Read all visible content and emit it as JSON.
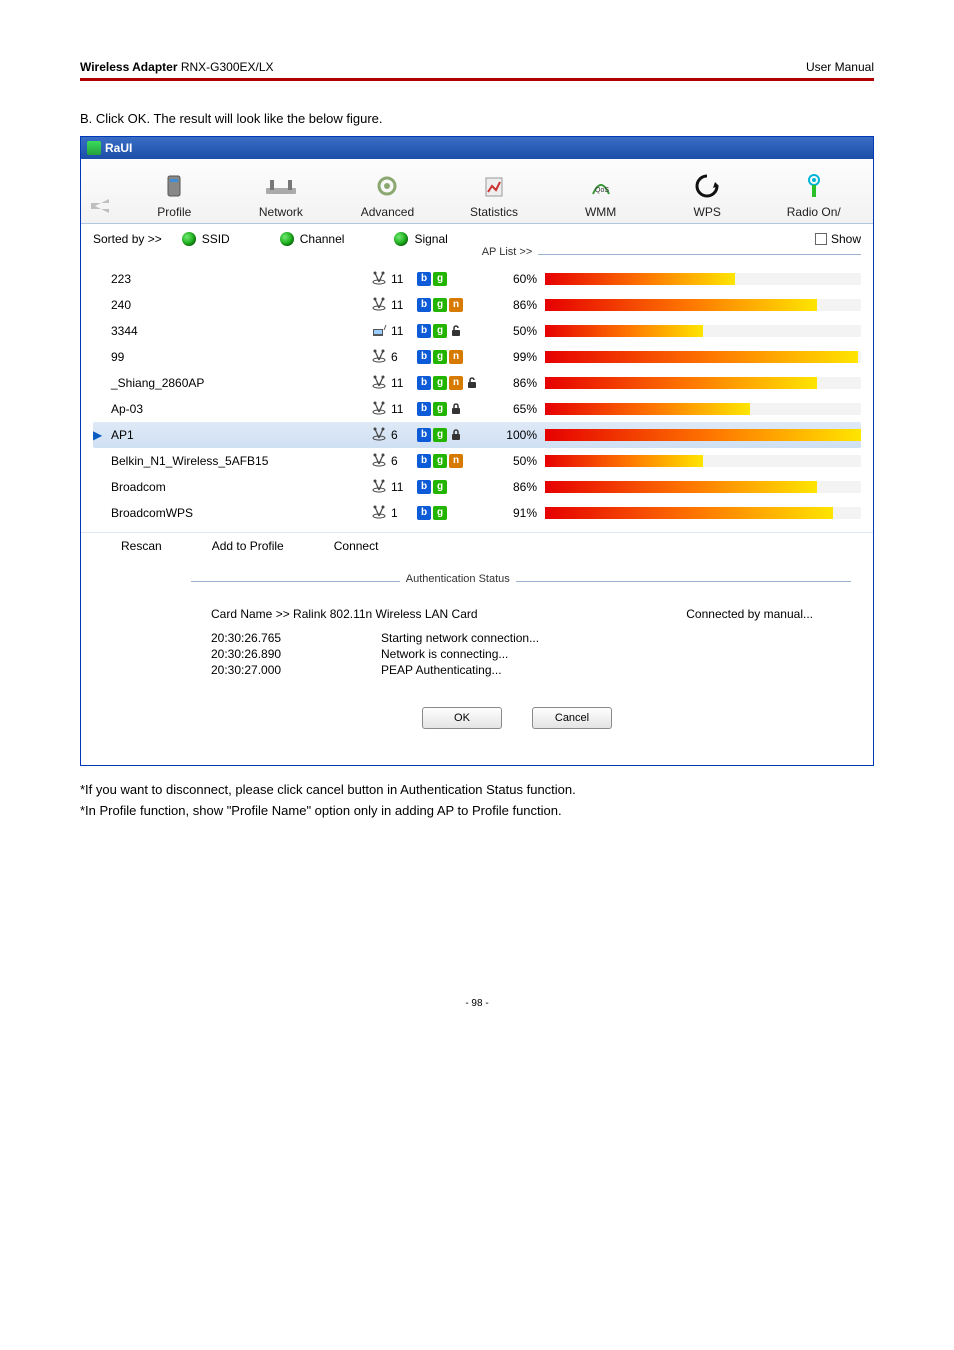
{
  "doc": {
    "header_left_bold": "Wireless Adapter",
    "header_left_model": "RNX-G300EX/LX",
    "header_right": "User Manual",
    "instruction": "B. Click OK. The result will look like the below figure.",
    "foot1": "*If you want to disconnect, please click cancel button in Authentication Status function.",
    "foot2": "*In Profile function, show \"Profile Name\" option only in adding AP to Profile function.",
    "page_number": "- 98 -"
  },
  "app": {
    "title": "RaUI"
  },
  "toolbar": [
    {
      "label": "Profile"
    },
    {
      "label": "Network"
    },
    {
      "label": "Advanced"
    },
    {
      "label": "Statistics"
    },
    {
      "label": "WMM"
    },
    {
      "label": "WPS"
    },
    {
      "label": "Radio On/"
    }
  ],
  "sort": {
    "label": "Sorted by >>",
    "opts": [
      "SSID",
      "Channel",
      "Signal"
    ],
    "show": "Show",
    "legend": "AP List >>"
  },
  "ap_list": [
    {
      "ssid": "223",
      "channel": "11",
      "adhoc": false,
      "b": true,
      "g": true,
      "n": false,
      "lock": null,
      "signal": "60%",
      "pct": 60,
      "selected": false
    },
    {
      "ssid": "240",
      "channel": "11",
      "adhoc": false,
      "b": true,
      "g": true,
      "n": true,
      "lock": null,
      "signal": "86%",
      "pct": 86,
      "selected": false
    },
    {
      "ssid": "3344",
      "channel": "11",
      "adhoc": true,
      "b": true,
      "g": true,
      "n": false,
      "lock": "open",
      "signal": "50%",
      "pct": 50,
      "selected": false
    },
    {
      "ssid": "99",
      "channel": "6",
      "adhoc": false,
      "b": true,
      "g": true,
      "n": true,
      "lock": null,
      "signal": "99%",
      "pct": 99,
      "selected": false
    },
    {
      "ssid": "_Shiang_2860AP",
      "channel": "11",
      "adhoc": false,
      "b": true,
      "g": true,
      "n": true,
      "lock": "open",
      "signal": "86%",
      "pct": 86,
      "selected": false
    },
    {
      "ssid": "Ap-03",
      "channel": "11",
      "adhoc": false,
      "b": true,
      "g": true,
      "n": false,
      "lock": "closed",
      "signal": "65%",
      "pct": 65,
      "selected": false
    },
    {
      "ssid": "AP1",
      "channel": "6",
      "adhoc": false,
      "b": true,
      "g": true,
      "n": false,
      "lock": "closed",
      "signal": "100%",
      "pct": 100,
      "selected": true
    },
    {
      "ssid": "Belkin_N1_Wireless_5AFB15",
      "channel": "6",
      "adhoc": false,
      "b": true,
      "g": true,
      "n": true,
      "lock": null,
      "signal": "50%",
      "pct": 50,
      "selected": false
    },
    {
      "ssid": "Broadcom",
      "channel": "11",
      "adhoc": false,
      "b": true,
      "g": true,
      "n": false,
      "lock": null,
      "signal": "86%",
      "pct": 86,
      "selected": false
    },
    {
      "ssid": "BroadcomWPS",
      "channel": "1",
      "adhoc": false,
      "b": true,
      "g": true,
      "n": false,
      "lock": null,
      "signal": "91%",
      "pct": 91,
      "selected": false
    }
  ],
  "btns": {
    "rescan": "Rescan",
    "add": "Add to Profile",
    "connect": "Connect"
  },
  "auth": {
    "legend": "Authentication Status",
    "card_label": "Card Name >> Ralink 802.11n Wireless LAN Card",
    "connected": "Connected by manual...",
    "log": [
      {
        "t": "20:30:26.765",
        "m": "Starting network connection..."
      },
      {
        "t": "20:30:26.890",
        "m": "Network is connecting..."
      },
      {
        "t": "20:30:27.000",
        "m": "PEAP Authenticating..."
      }
    ],
    "ok": "OK",
    "cancel": "Cancel"
  }
}
